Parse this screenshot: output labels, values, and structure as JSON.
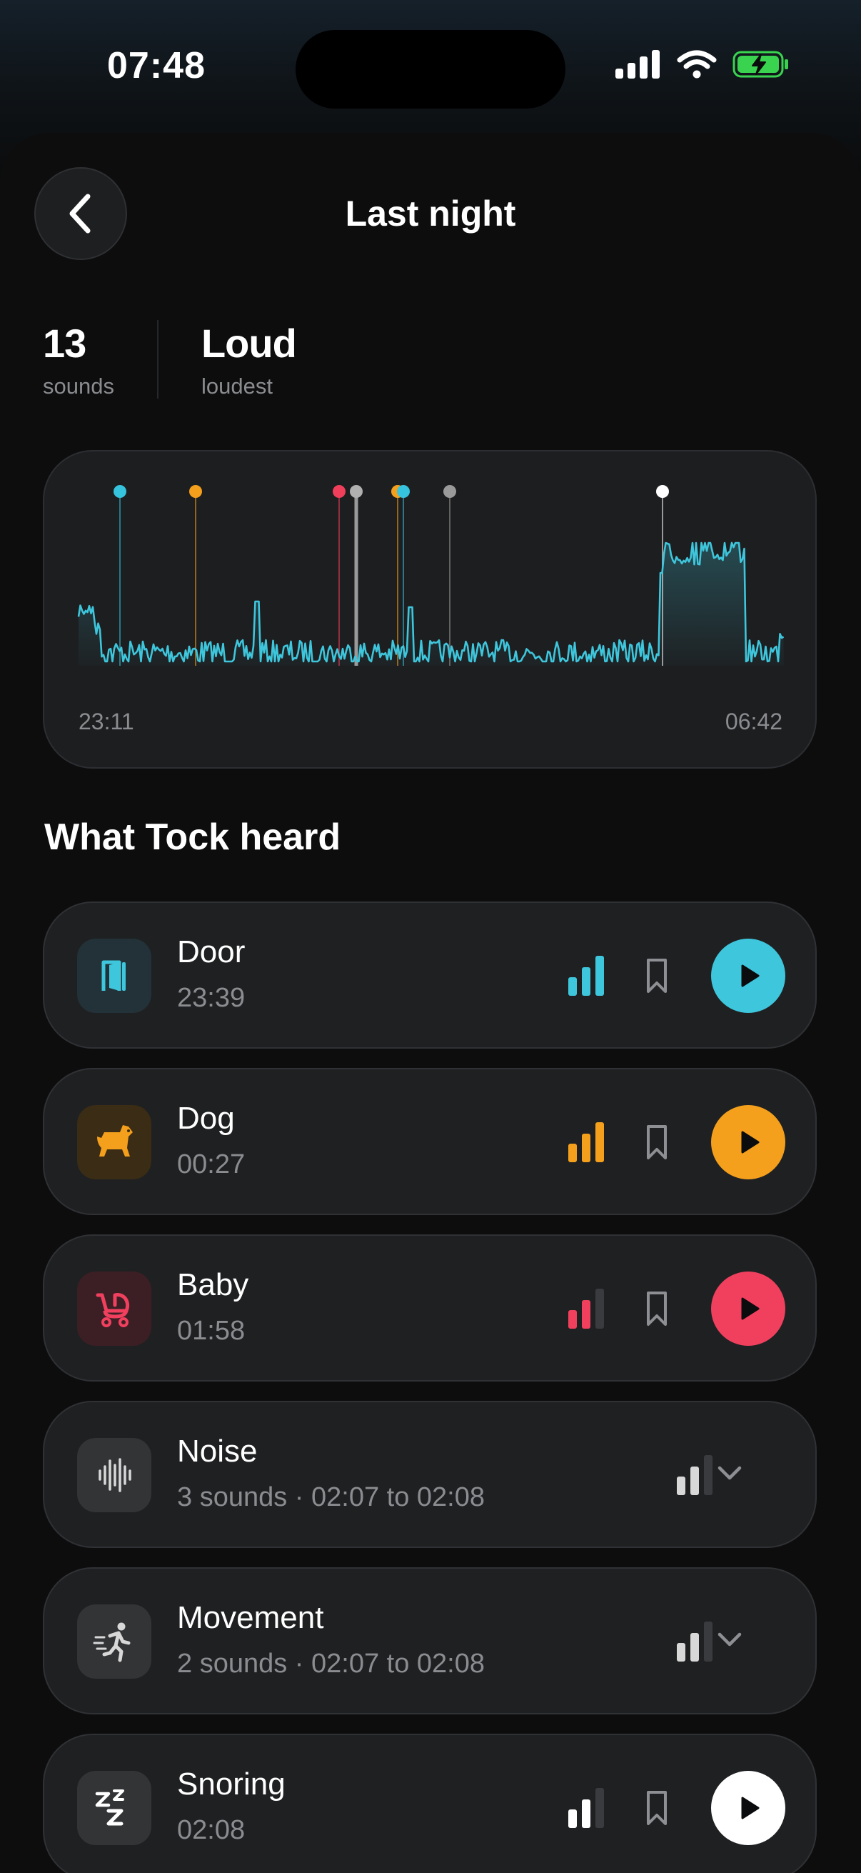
{
  "status": {
    "time": "07:48"
  },
  "header": {
    "title": "Last night"
  },
  "stats": [
    {
      "value": "13",
      "label": "sounds"
    },
    {
      "value": "Loud",
      "label": "loudest"
    }
  ],
  "chart_data": {
    "type": "line",
    "x_start_label": "23:11",
    "x_end_label": "06:42",
    "grid": false,
    "series_color": "#3ec6dc",
    "event_markers": [
      {
        "color": "#36c3dd",
        "kind": "Door"
      },
      {
        "color": "#f5a01c",
        "kind": "Dog"
      },
      {
        "color": "#ef3f5b",
        "kind": "Baby"
      },
      {
        "color": "#b0b0b0",
        "kind": "Noise"
      },
      {
        "color": "#f5a01c",
        "kind": "marker"
      },
      {
        "color": "#36c3dd",
        "kind": "marker"
      },
      {
        "color": "#9a9a9a",
        "kind": "marker"
      },
      {
        "color": "#ffffff",
        "kind": "Snoring"
      }
    ]
  },
  "section_title": "What Tock heard",
  "items": [
    {
      "name": "Door",
      "sub": "23:39",
      "icon": "door-icon",
      "color": "#3ec6dc",
      "icon_bg": "#233238",
      "level": 3,
      "bookmark": true,
      "action": "play"
    },
    {
      "name": "Dog",
      "sub": "00:27",
      "icon": "dog-icon",
      "color": "#f5a01c",
      "icon_bg": "#3a2c15",
      "level": 3,
      "bookmark": true,
      "action": "play"
    },
    {
      "name": "Baby",
      "sub": "01:58",
      "icon": "stroller-icon",
      "color": "#f0405e",
      "icon_bg": "#3c1f25",
      "level": 2,
      "bookmark": true,
      "action": "play"
    },
    {
      "name": "Noise",
      "sub": "3 sounds · 02:07 to 02:08",
      "icon": "waveform-icon",
      "color": "#d8d8d8",
      "icon_bg": "#333436",
      "level": 2,
      "bookmark": false,
      "action": "expand"
    },
    {
      "name": "Movement",
      "sub": "2 sounds · 02:07 to 02:08",
      "icon": "person-moving-icon",
      "color": "#d8d8d8",
      "icon_bg": "#333436",
      "level": 2,
      "bookmark": false,
      "action": "expand"
    },
    {
      "name": "Snoring",
      "sub": "02:08",
      "icon": "zzz-icon",
      "color": "#ffffff",
      "icon_bg": "#333436",
      "level": 2,
      "bookmark": true,
      "action": "play"
    }
  ]
}
